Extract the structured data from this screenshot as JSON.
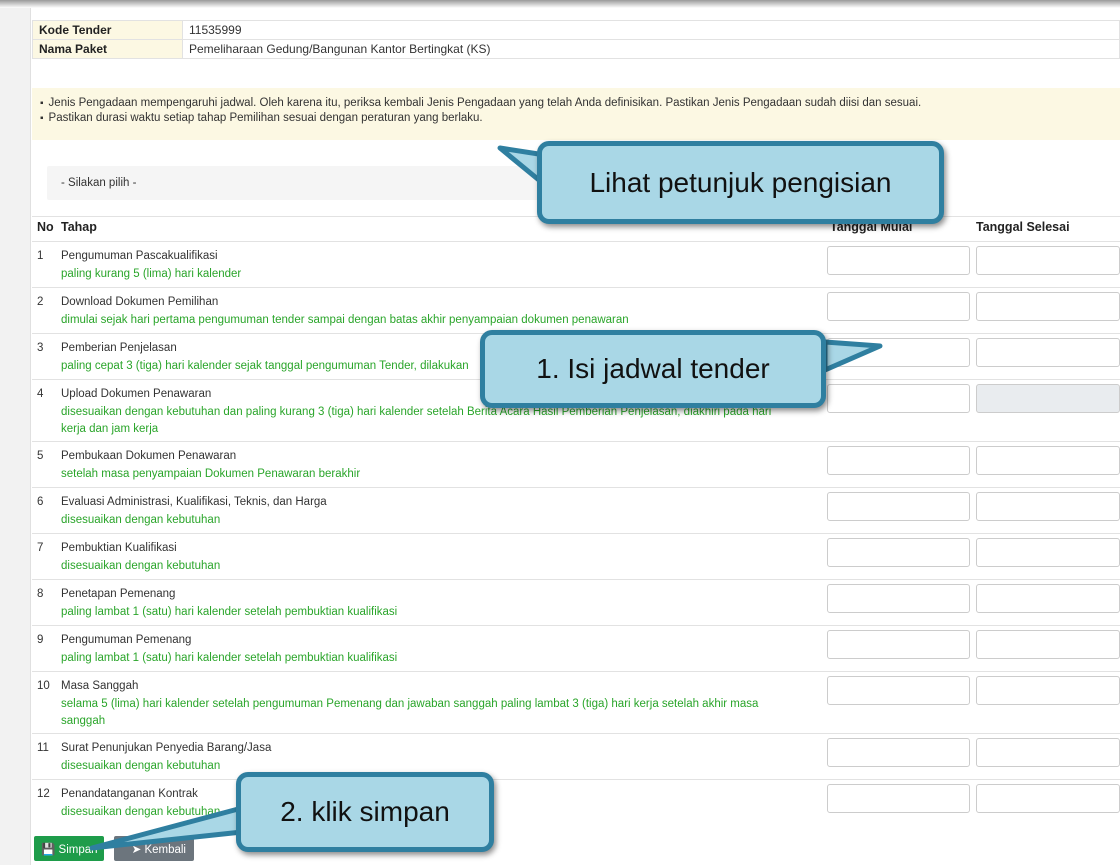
{
  "tender": {
    "kode_label": "Kode Tender",
    "kode_value": "11535999",
    "paket_label": "Nama Paket",
    "paket_value": "Pemeliharaan Gedung/Bangunan Kantor Bertingkat (KS)"
  },
  "notice": [
    "Jenis Pengadaan mempengaruhi jadwal. Oleh karena itu, periksa kembali Jenis Pengadaan yang telah Anda definisikan. Pastikan Jenis Pengadaan sudah diisi dan sesuai.",
    "Pastikan durasi waktu setiap tahap Pemilihan sesuai dengan peraturan yang berlaku."
  ],
  "select_value": "- Silakan pilih -",
  "table": {
    "col_no": "No",
    "col_tahap": "Tahap",
    "col_mulai": "Tanggal Mulai",
    "col_selesai": "Tanggal Selesai",
    "rows": [
      {
        "no": "1",
        "name": "Pengumuman Pascakualifikasi",
        "note": "paling kurang 5 (lima) hari kalender"
      },
      {
        "no": "2",
        "name": "Download Dokumen Pemilihan",
        "note": "dimulai sejak hari pertama pengumuman tender sampai dengan batas akhir penyampaian dokumen penawaran"
      },
      {
        "no": "3",
        "name": "Pemberian Penjelasan",
        "note": "paling cepat 3 (tiga) hari kalender sejak tanggal pengumuman Tender, dilakukan"
      },
      {
        "no": "4",
        "name": "Upload Dokumen Penawaran",
        "note": "disesuaikan dengan kebutuhan dan paling kurang 3 (tiga) hari kalender setelah Berita Acara Hasil Pemberian Penjelasan, diakhiri pada hari",
        "note2": "kerja dan jam kerja"
      },
      {
        "no": "5",
        "name": "Pembukaan Dokumen Penawaran",
        "note": "setelah masa penyampaian Dokumen Penawaran berakhir"
      },
      {
        "no": "6",
        "name": "Evaluasi Administrasi, Kualifikasi, Teknis, dan Harga",
        "note": "disesuaikan dengan kebutuhan"
      },
      {
        "no": "7",
        "name": "Pembuktian Kualifikasi",
        "note": "disesuaikan dengan kebutuhan"
      },
      {
        "no": "8",
        "name": "Penetapan Pemenang",
        "note": "paling lambat 1 (satu) hari kalender setelah pembuktian kualifikasi"
      },
      {
        "no": "9",
        "name": "Pengumuman Pemenang",
        "note": "paling lambat 1 (satu) hari kalender setelah pembuktian kualifikasi"
      },
      {
        "no": "10",
        "name": "Masa Sanggah",
        "note": "selama 5 (lima) hari kalender setelah pengumuman Pemenang dan jawaban sanggah paling lambat 3 (tiga) hari kerja setelah akhir masa",
        "note2": "sanggah"
      },
      {
        "no": "11",
        "name": "Surat Penunjukan Penyedia Barang/Jasa",
        "note": "disesuaikan dengan kebutuhan"
      },
      {
        "no": "12",
        "name": "Penandatanganan Kontrak",
        "note": "disesuaikan dengan kebutuhan"
      }
    ]
  },
  "buttons": {
    "simpan": "Simpan",
    "kembali": "Kembali"
  },
  "callouts": {
    "petunjuk": "Lihat petunjuk pengisian",
    "jadwal": "1.  Isi jadwal tender",
    "simpan": "2. klik simpan"
  },
  "colors": {
    "note_green": "#2aa52a",
    "callout_fill": "#a9d7e6",
    "callout_border": "#2f7fa0",
    "simpan_button": "#1e9c4a",
    "notice_bg": "#fcf8e3"
  }
}
